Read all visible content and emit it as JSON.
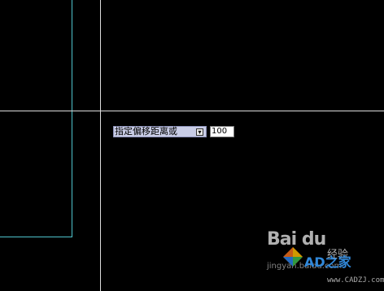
{
  "drawing": {
    "geometry_color": "#4fc4cc",
    "crosshair_color": "#dcdcdc",
    "background": "#000000"
  },
  "dynamic_input": {
    "prompt": "指定偏移距离或",
    "icon": "dropdown-arrow-icon",
    "value": "100"
  },
  "watermark": {
    "brand": "Bai du",
    "subtitle": "经验",
    "url_partial": "jingyan.baidu.com",
    "logo_text": "AD之家",
    "site": "www.CADZJ.com"
  }
}
